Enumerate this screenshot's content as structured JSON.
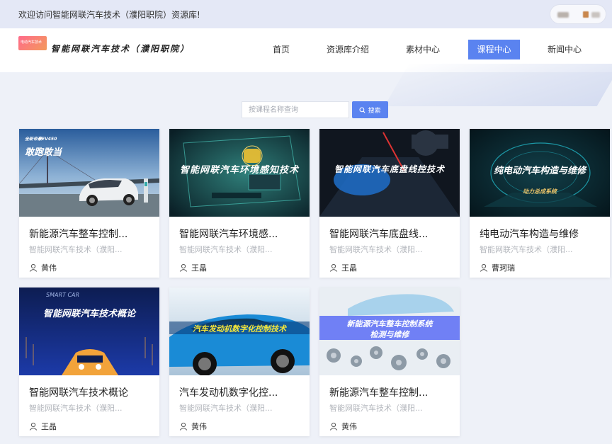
{
  "topbar": {
    "welcome": "欢迎访问智能网联汽车技术（濮阳职院）资源库!"
  },
  "header": {
    "logo_badge": "电动汽车技术",
    "site_name": "智能网联汽车技术（濮阳职院）"
  },
  "nav": {
    "items": [
      {
        "label": "首页"
      },
      {
        "label": "资源库介绍"
      },
      {
        "label": "素材中心"
      },
      {
        "label": "课程中心"
      },
      {
        "label": "新闻中心"
      }
    ],
    "active": "课程中心"
  },
  "search": {
    "placeholder": "按课程名称查询",
    "button_label": "搜索"
  },
  "courses": [
    {
      "title": "新能源汽车整车控制...",
      "subtitle": "智能网联汽车技术（濮阳...",
      "teacher": "黄伟",
      "thumb_text": "敢跑敢当",
      "thumb_badge": "全新帝豪EV450"
    },
    {
      "title": "智能网联汽车环境感...",
      "subtitle": "智能网联汽车技术（濮阳...",
      "teacher": "王晶",
      "thumb_text": "智能网联汽车环境感知技术"
    },
    {
      "title": "智能网联汽车底盘线...",
      "subtitle": "智能网联汽车技术（濮阳...",
      "teacher": "王晶",
      "thumb_text": "智能网联汽车底盘线控技术"
    },
    {
      "title": "纯电动汽车构造与维修",
      "subtitle": "智能网联汽车技术（濮阳...",
      "teacher": "曹珂瑞",
      "thumb_text": "纯电动汽车构造与维修",
      "thumb_sub": "动力总成系统"
    },
    {
      "title": "智能网联汽车技术概论",
      "subtitle": "智能网联汽车技术（濮阳...",
      "teacher": "王晶",
      "thumb_text": "智能网联汽车技术概论",
      "thumb_badge": "SMART CAR"
    },
    {
      "title": "汽车发动机数字化控...",
      "subtitle": "智能网联汽车技术（濮阳...",
      "teacher": "黄伟",
      "thumb_text": "汽车发动机数字化控制技术"
    },
    {
      "title": "新能源汽车整车控制...",
      "subtitle": "智能网联汽车技术（濮阳...",
      "teacher": "黄伟",
      "thumb_text": "新能源汽车整车控制系统",
      "thumb_sub": "检测与维修"
    }
  ],
  "colors": {
    "accent": "#5a83f0",
    "topbar_bg": "#e4e8f6",
    "page_bg": "#eef1f8"
  }
}
